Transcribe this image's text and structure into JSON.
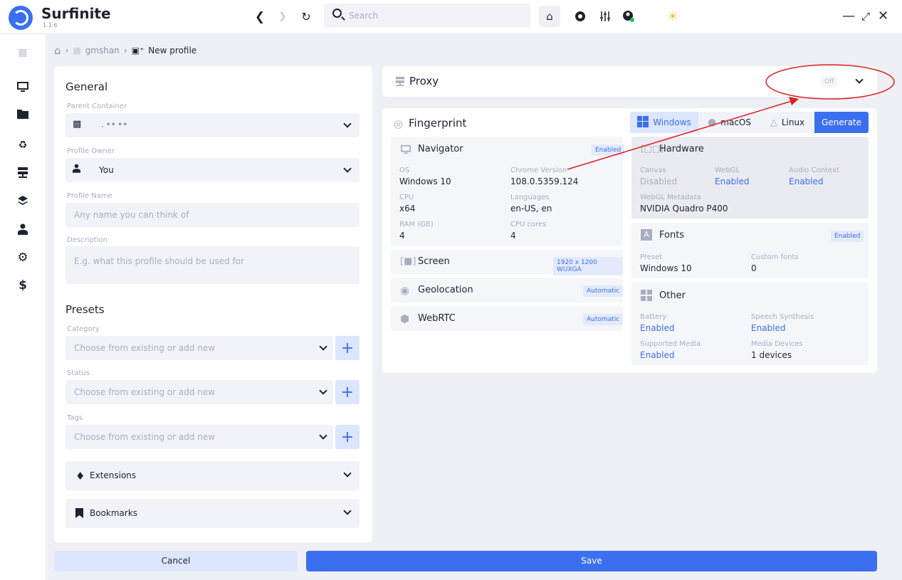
{
  "app": {
    "name": "Surfinite",
    "version": "1.1.6"
  },
  "toolbar": {
    "search_placeholder": "Search"
  },
  "breadcrumb": {
    "parent": "gmshan",
    "current": "New profile"
  },
  "general": {
    "title": "General",
    "parent_container_label": "Parent Container",
    "parent_container_value": " . •• ••",
    "profile_owner_label": "Profile Owner",
    "profile_owner_value": "You",
    "profile_name_label": "Profile Name",
    "profile_name_placeholder": "Any name you can think of",
    "description_label": "Description",
    "description_placeholder": "E.g. what this profile should be used for"
  },
  "presets": {
    "title": "Presets",
    "category_label": "Category",
    "category_placeholder": "Choose from existing or add new",
    "status_label": "Status",
    "status_placeholder": "Choose from existing or add new",
    "tags_label": "Tags",
    "tags_placeholder": "Choose from existing or add new"
  },
  "extensions": {
    "label": "Extensions"
  },
  "bookmarks": {
    "label": "Bookmarks"
  },
  "proxy": {
    "title": "Proxy",
    "status": "Off"
  },
  "fingerprint": {
    "title": "Fingerprint",
    "os_tabs": [
      "Windows",
      "macOS",
      "Linux"
    ],
    "selected_os": "Windows",
    "generate_label": "Generate",
    "navigator": {
      "title": "Navigator",
      "badge": "Enabled",
      "os_label": "OS",
      "os_value": "Windows 10",
      "chrome_label": "Chrome Version",
      "chrome_value": "108.0.5359.124",
      "cpu_label": "CPU",
      "cpu_value": "x64",
      "languages_label": "Languages",
      "languages_value": "en-US, en",
      "ram_label": "RAM (GB)",
      "ram_value": "4",
      "cores_label": "CPU cores",
      "cores_value": "4"
    },
    "screen": {
      "title": "Screen",
      "badge": "1920 x 1200 WUXGA"
    },
    "geolocation": {
      "title": "Geolocation",
      "badge": "Automatic"
    },
    "webrtc": {
      "title": "WebRTC",
      "badge": "Automatic"
    },
    "hardware": {
      "title": "Hardware",
      "canvas_label": "Canvas",
      "canvas_value": "Disabled",
      "webgl_label": "WebGL",
      "webgl_value": "Enabled",
      "audio_label": "Audio Context",
      "audio_value": "Enabled",
      "webgl_meta_label": "WebGL Metadata",
      "webgl_meta_value": "NVIDIA Quadro P400"
    },
    "fonts": {
      "title": "Fonts",
      "badge": "Enabled",
      "preset_label": "Preset",
      "preset_value": "Windows 10",
      "custom_label": "Custom fonts",
      "custom_value": "0"
    },
    "other": {
      "title": "Other",
      "battery_label": "Battery",
      "battery_value": "Enabled",
      "speech_label": "Speech Synthesis",
      "speech_value": "Enabled",
      "media_label": "Supported Media",
      "media_value": "Enabled",
      "devices_label": "Media Devices",
      "devices_value": "1 devices"
    }
  },
  "actions": {
    "cancel": "Cancel",
    "save": "Save"
  },
  "colors": {
    "accent": "#3b6ff0",
    "annotation": "#e02020"
  }
}
